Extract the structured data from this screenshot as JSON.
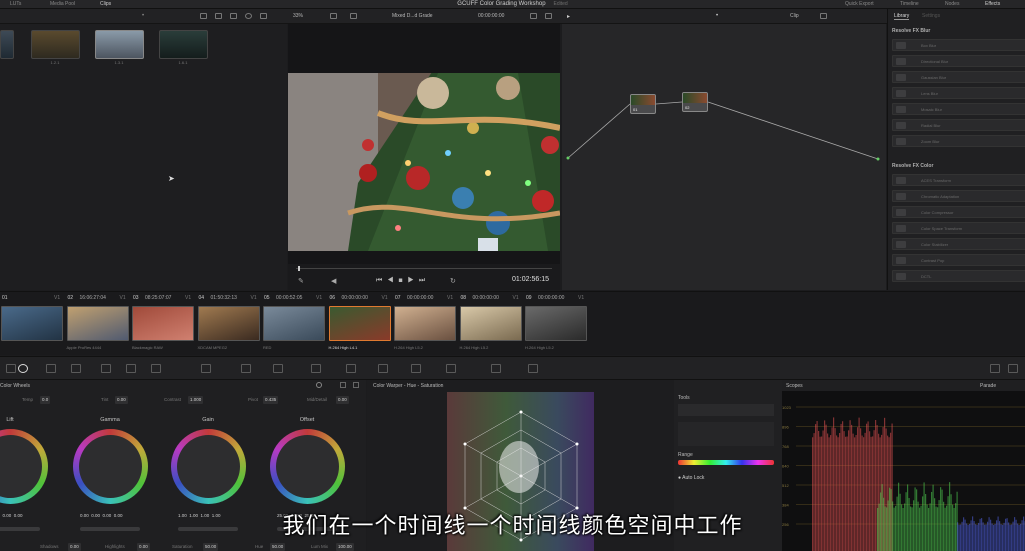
{
  "topbar": {
    "tabs": [
      "LUTs",
      "Media Pool",
      "Clips"
    ],
    "title": "GCUFF Color Grading Workshop",
    "title_sub": "Edited",
    "right": [
      "Quick Export",
      "Timeline",
      "Nodes",
      "Effects"
    ]
  },
  "viewer": {
    "zoom": "33%",
    "mode": "Mixed D...d Grade",
    "timecode_top": "00:00:00:00",
    "clip_label": "Clip",
    "timecode": "01:02:56:15"
  },
  "media_pool": {
    "clips": [
      {
        "label": "1.2.1"
      },
      {
        "label": "1.3.1"
      },
      {
        "label": "1.6.1"
      }
    ]
  },
  "nodes": [
    {
      "label": "01"
    },
    {
      "label": "02"
    }
  ],
  "library": {
    "tab_active": "Library",
    "tab_other": "Settings",
    "section1": "Resolve FX Blur",
    "items1": [
      "Box Blur",
      "Directional Blur",
      "Gaussian Blur",
      "Lens Blur",
      "Mosaic Blur",
      "Radial Blur",
      "Zoom Blur"
    ],
    "section2": "Resolve FX Color",
    "items2": [
      "ACES Transform",
      "Chromatic Adaptation",
      "Color Compressor",
      "Color Space Transform",
      "Color Stabilizer",
      "Contrast Pop",
      "DCTL"
    ]
  },
  "timeline": {
    "clips": [
      {
        "num": "01",
        "tc": "",
        "label": ""
      },
      {
        "num": "02",
        "tc": "16:06:27:04",
        "label": "Apple ProRes 4444"
      },
      {
        "num": "03",
        "tc": "08:25:07:07",
        "label": "Blackmagic RAW"
      },
      {
        "num": "04",
        "tc": "01:50:32:13",
        "label": "XDCAM MPEG2"
      },
      {
        "num": "05",
        "tc": "00:00:52:05",
        "label": "RED"
      },
      {
        "num": "06",
        "tc": "00:00:00:00",
        "label": "H.264 High L4.1"
      },
      {
        "num": "07",
        "tc": "00:00:00:00",
        "label": "H.264 High L5.2"
      },
      {
        "num": "08",
        "tc": "00:00:00:00",
        "label": "H.264 High L5.2"
      },
      {
        "num": "09",
        "tc": "00:00:00:00",
        "label": "H.264 High L5.2"
      }
    ],
    "track": "V1"
  },
  "wheels": {
    "title": "Color Wheels",
    "params": [
      {
        "name": "Temp",
        "value": "0.0"
      },
      {
        "name": "Tint",
        "value": "0.00"
      },
      {
        "name": "Contrast",
        "value": "1.000"
      },
      {
        "name": "Pivot",
        "value": "0.435"
      },
      {
        "name": "Mid/Detail",
        "value": "0.00"
      }
    ],
    "wheels": [
      {
        "name": "Lift",
        "values": "0.00  0.00  0.00  0.00"
      },
      {
        "name": "Gamma",
        "values": "0.00  0.00  0.00  0.00"
      },
      {
        "name": "Gain",
        "values": "1.00  1.00  1.00  1.00"
      },
      {
        "name": "Offset",
        "values": "25.00  25.00  25.00"
      }
    ],
    "bottom": [
      {
        "name": "Shadows",
        "value": "0.00"
      },
      {
        "name": "Highlights",
        "value": "0.00"
      },
      {
        "name": "Saturation",
        "value": "50.00"
      },
      {
        "name": "Hue",
        "value": "50.00"
      },
      {
        "name": "Lum Mix",
        "value": "100.00"
      }
    ]
  },
  "warper": {
    "title": "Color Warper - Hue - Saturation"
  },
  "tools": {
    "title": "Tools",
    "range": "Range",
    "auto_lock": "Auto Lock"
  },
  "scopes": {
    "title": "Scopes",
    "mode": "Parade",
    "scale": [
      "1023",
      "896",
      "768",
      "640",
      "512",
      "384",
      "256"
    ]
  },
  "subtitle": "我们在一个时间线一个时间线颜色空间中工作",
  "chart_data": {
    "type": "bar",
    "title": "Scopes",
    "subtitle": "Parade",
    "y_ticks": [
      "1023",
      "896",
      "768",
      "640",
      "512",
      "384",
      "256"
    ],
    "ylim": [
      256,
      1023
    ],
    "series": [
      {
        "name": "",
        "color": "#e05050",
        "values": []
      },
      {
        "name": "",
        "color": "#50d050",
        "values": []
      },
      {
        "name": "",
        "color": "#5060e0",
        "values": []
      }
    ]
  }
}
